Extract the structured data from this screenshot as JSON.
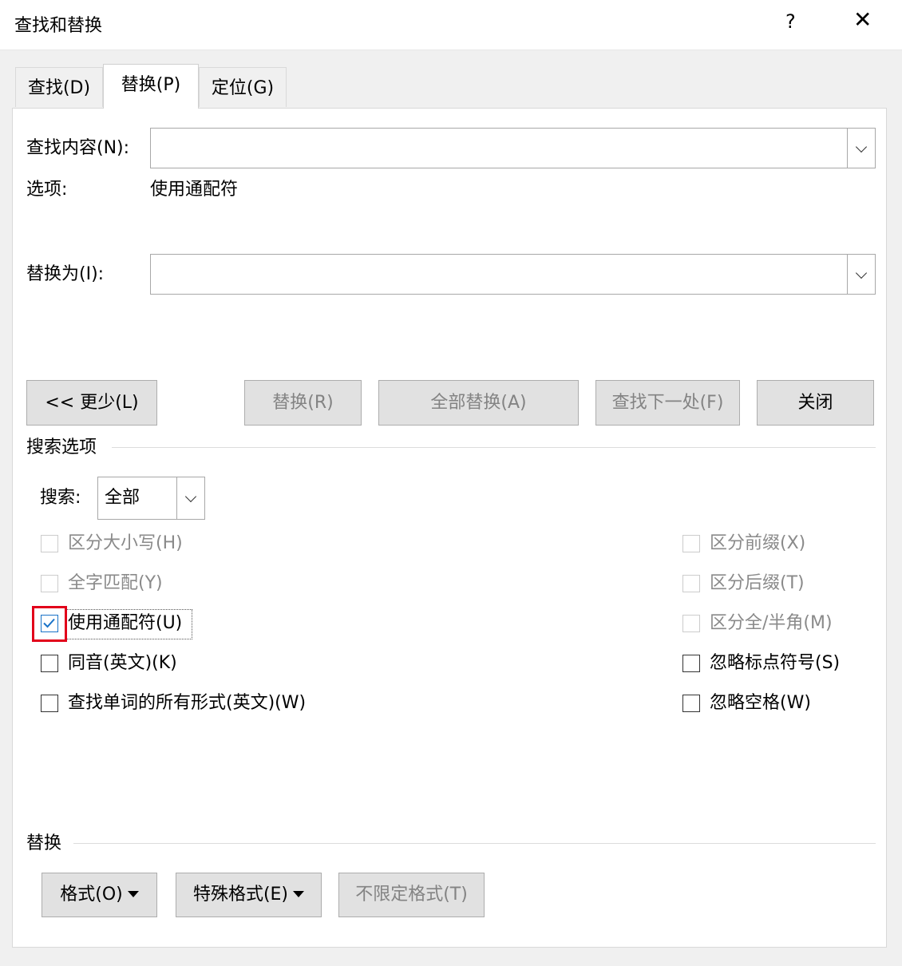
{
  "window": {
    "title": "查找和替换",
    "help_label": "?",
    "close_label": "✕"
  },
  "tabs": [
    {
      "label": "查找(D)",
      "active": false
    },
    {
      "label": "替换(P)",
      "active": true
    },
    {
      "label": "定位(G)",
      "active": false
    }
  ],
  "find": {
    "label": "查找内容(N):",
    "value": ""
  },
  "options": {
    "label": "选项:",
    "value": "使用通配符"
  },
  "replace": {
    "label": "替换为(I):",
    "value": ""
  },
  "buttons": {
    "less": "<< 更少(L)",
    "replace": "替换(R)",
    "replace_all": "全部替换(A)",
    "find_next": "查找下一处(F)",
    "close": "关闭"
  },
  "search_options": {
    "group_label": "搜索选项",
    "search_label": "搜索:",
    "search_value": "全部"
  },
  "checkboxes_left": [
    {
      "label": "区分大小写(H)",
      "checked": false,
      "enabled": false
    },
    {
      "label": "全字匹配(Y)",
      "checked": false,
      "enabled": false
    },
    {
      "label": "使用通配符(U)",
      "checked": true,
      "enabled": true
    },
    {
      "label": "同音(英文)(K)",
      "checked": false,
      "enabled": true
    },
    {
      "label": "查找单词的所有形式(英文)(W)",
      "checked": false,
      "enabled": true
    }
  ],
  "checkboxes_right": [
    {
      "label": "区分前缀(X)",
      "checked": false,
      "enabled": false
    },
    {
      "label": "区分后缀(T)",
      "checked": false,
      "enabled": false
    },
    {
      "label": "区分全/半角(M)",
      "checked": false,
      "enabled": false
    },
    {
      "label": "忽略标点符号(S)",
      "checked": false,
      "enabled": true
    },
    {
      "label": "忽略空格(W)",
      "checked": false,
      "enabled": true
    }
  ],
  "replace_section": {
    "group_label": "替换",
    "format": "格式(O)",
    "special": "特殊格式(E)",
    "no_format": "不限定格式(T)"
  },
  "colors": {
    "highlight": "#e2001a",
    "check": "#1a73c8"
  }
}
